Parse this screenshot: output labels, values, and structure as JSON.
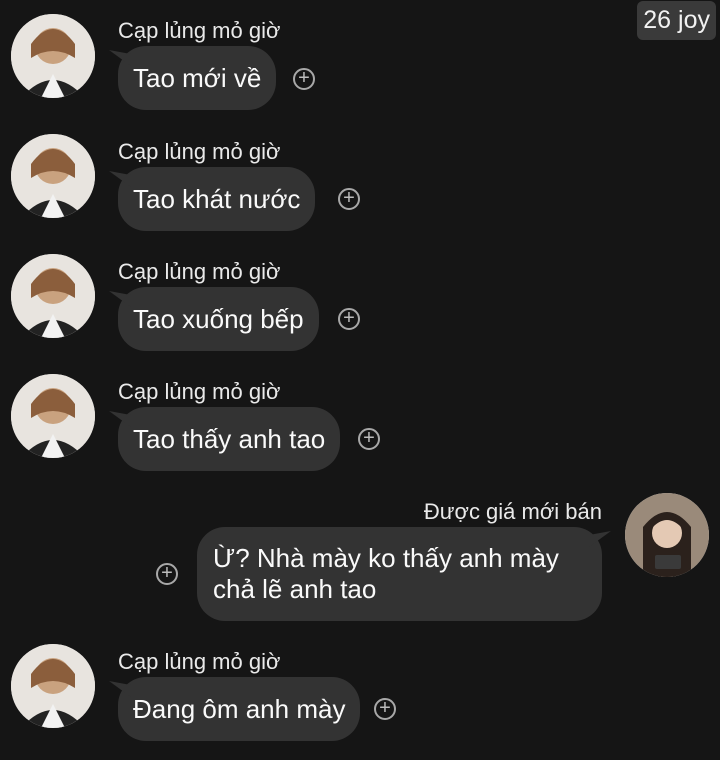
{
  "badge": "26 joy",
  "messages": [
    {
      "sender": "Cạp lủng mỏ giờ",
      "text": "Tao mới về"
    },
    {
      "sender": "Cạp lủng mỏ giờ",
      "text": "Tao khát nước"
    },
    {
      "sender": "Cạp lủng mỏ giờ",
      "text": "Tao xuống bếp"
    },
    {
      "sender": "Cạp lủng mỏ giờ",
      "text": "Tao thấy anh tao"
    },
    {
      "sender": "Được giá mới bán",
      "line1": "Ừ? Nhà mày ko thấy anh mày",
      "line2": "chả lẽ anh tao"
    },
    {
      "sender": "Cạp lủng mỏ giờ",
      "text": "Đang ôm anh mày"
    }
  ],
  "icons": {
    "add": "add-reaction-icon",
    "add_glyph": "+"
  },
  "colors": {
    "background": "#151515",
    "bubble": "#333333",
    "text": "#fafafa"
  }
}
